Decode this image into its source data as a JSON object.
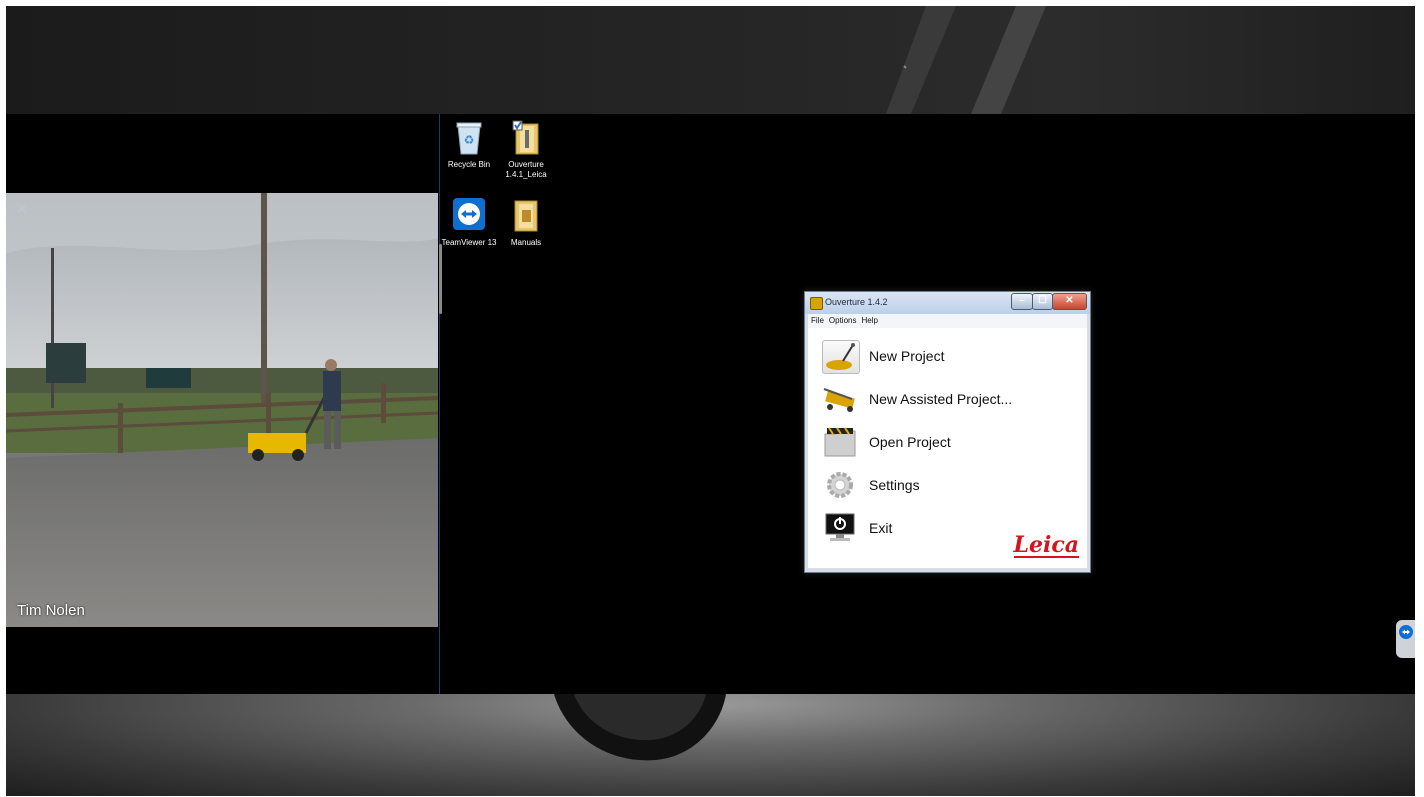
{
  "webcam": {
    "participant_name": "Tim  Nolen"
  },
  "desktop": {
    "icons": [
      {
        "label": "Recycle Bin"
      },
      {
        "label": "Ouverture 1.4.1_Leica"
      },
      {
        "label": "TeamViewer 13"
      },
      {
        "label": "Manuals"
      }
    ]
  },
  "app": {
    "title": "Ouverture 1.4.2",
    "menu": [
      "File",
      "Options",
      "Help"
    ],
    "entries": [
      {
        "label": "New Project",
        "icon": "gpr-cart-icon"
      },
      {
        "label": "New Assisted Project...",
        "icon": "gpr-wizard-icon"
      },
      {
        "label": "Open Project",
        "icon": "folder-icon"
      },
      {
        "label": "Settings",
        "icon": "gear-icon"
      },
      {
        "label": "Exit",
        "icon": "power-monitor-icon"
      }
    ],
    "brand": "Leica",
    "window_controls": {
      "minimize": "–",
      "maximize": "☐",
      "close": "✕"
    },
    "colors": {
      "brand": "#d4151b",
      "title_bar": "#bcd0ea"
    }
  }
}
